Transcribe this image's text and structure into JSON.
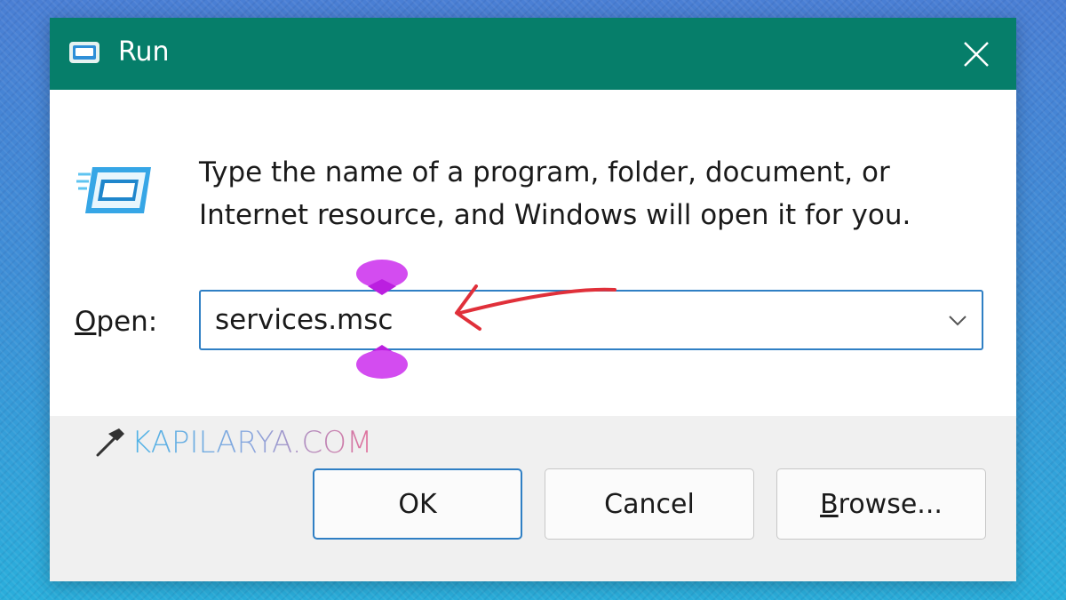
{
  "window": {
    "title": "Run",
    "icon": "run-icon",
    "close_icon": "close-icon"
  },
  "description": {
    "line1": "Type the name of a program, folder, document, or",
    "line2": "Internet resource, and Windows will open it for you."
  },
  "open_field": {
    "label_mnemonic": "O",
    "label_rest": "pen:",
    "value": "services.msc",
    "dropdown_icon": "chevron-down-icon"
  },
  "buttons": {
    "ok": "OK",
    "cancel": "Cancel",
    "browse_mnemonic": "B",
    "browse_rest": "rowse..."
  },
  "watermark": {
    "text": "KAPILARYA.COM",
    "icon": "hammer-icon"
  },
  "colors": {
    "titlebar": "#067e6a",
    "accent": "#2f7fc4",
    "annotation_arrow": "#e0303a",
    "caret_handles": "#cc33ee"
  }
}
